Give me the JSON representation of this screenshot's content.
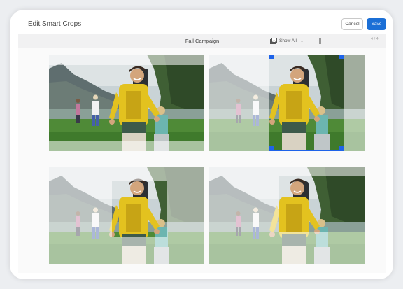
{
  "window": {
    "title": "Edit Smart Crops"
  },
  "header": {
    "cancel_label": "Cancel",
    "save_label": "Save"
  },
  "toolbar": {
    "campaign_name": "Fall Campaign",
    "view_filter": "Show All",
    "pager_text": "4 / 4"
  },
  "icons": {
    "view": "image-stack-icon",
    "dropdown": "chevron-down-icon",
    "slider": "zoom-slider"
  },
  "crops": [
    {
      "name": "crop-1",
      "selected": false
    },
    {
      "name": "crop-2",
      "selected": true
    },
    {
      "name": "crop-3",
      "selected": false
    },
    {
      "name": "crop-4",
      "selected": false
    }
  ],
  "colors": {
    "accent": "#1b6fd6",
    "crop_outline": "#1e63e9",
    "toolbar_bg": "#f1f1f2",
    "jacket": "#e3c21f"
  }
}
